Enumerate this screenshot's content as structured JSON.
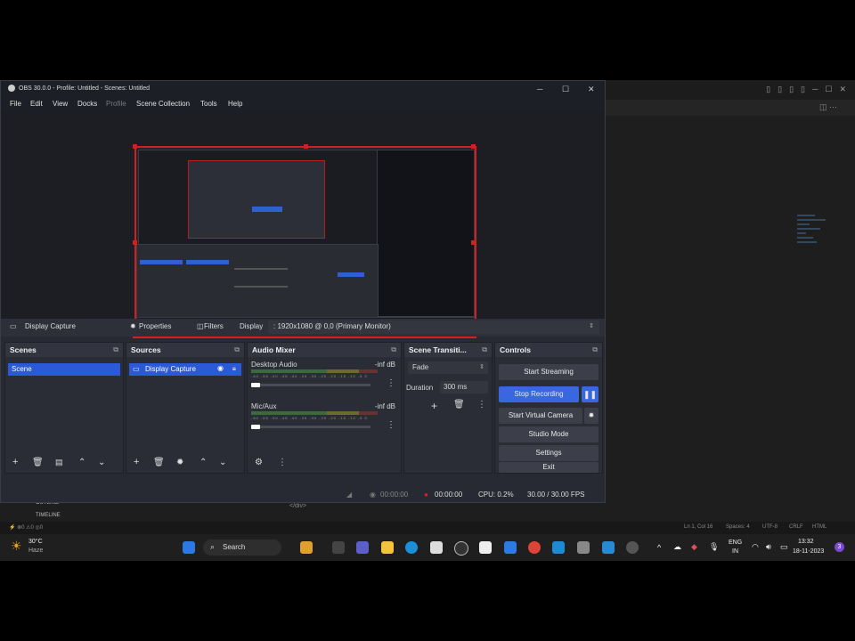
{
  "window": {
    "title": "OBS 30.0.0 - Profile: Untitled - Scenes: Untitled",
    "minimize": "─",
    "maximize": "☐",
    "close": "✕"
  },
  "menu": [
    "File",
    "Edit",
    "View",
    "Docks",
    "Profile",
    "Scene Collection",
    "Tools",
    "Help"
  ],
  "source_toolbar": {
    "source_name": "Display Capture",
    "properties": "Properties",
    "filters": "Filters",
    "display_label": "Display",
    "display_value": ": 1920x1080 @ 0,0 (Primary Monitor)"
  },
  "docks": {
    "scenes": {
      "title": "Scenes",
      "items": [
        "Scene"
      ]
    },
    "sources": {
      "title": "Sources",
      "items": [
        "Display Capture"
      ]
    },
    "mixer": {
      "title": "Audio Mixer",
      "channels": [
        {
          "name": "Desktop Audio",
          "level": "-inf dB"
        },
        {
          "name": "Mic/Aux",
          "level": "-inf dB"
        }
      ],
      "ticks": "-60 -55 -50 -45 -40 -35 -30 -25 -20 -15 -10 -5 0"
    },
    "transitions": {
      "title": "Scene Transiti...",
      "type": "Fade",
      "duration_label": "Duration",
      "duration_value": "300 ms"
    },
    "controls": {
      "title": "Controls",
      "start_streaming": "Start Streaming",
      "stop_recording": "Stop Recording",
      "start_virtual_camera": "Start Virtual Camera",
      "studio_mode": "Studio Mode",
      "settings": "Settings",
      "exit": "Exit"
    }
  },
  "statusbar": {
    "stream_time": "00:00:00",
    "rec_time": "00:00:00",
    "cpu": "CPU: 0.2%",
    "fps": "30.00 / 30.00 FPS"
  },
  "editor": {
    "outline": "OUTLINE",
    "timeline": "TIMELINE",
    "code_fragment": "</div>",
    "status_items": [
      "Ln 1, Col 16",
      "Spaces: 4",
      "UTF-8",
      "CRLF",
      "HTML"
    ]
  },
  "taskbar": {
    "weather_temp": "30°C",
    "weather_desc": "Haze",
    "search": "Search",
    "lang1": "ENG",
    "lang2": "IN",
    "time": "13:32",
    "date": "18-11-2023"
  },
  "colors": {
    "accent": "#2a5ad7",
    "record_border": "#d21f1f",
    "panel": "#2a2d36"
  }
}
